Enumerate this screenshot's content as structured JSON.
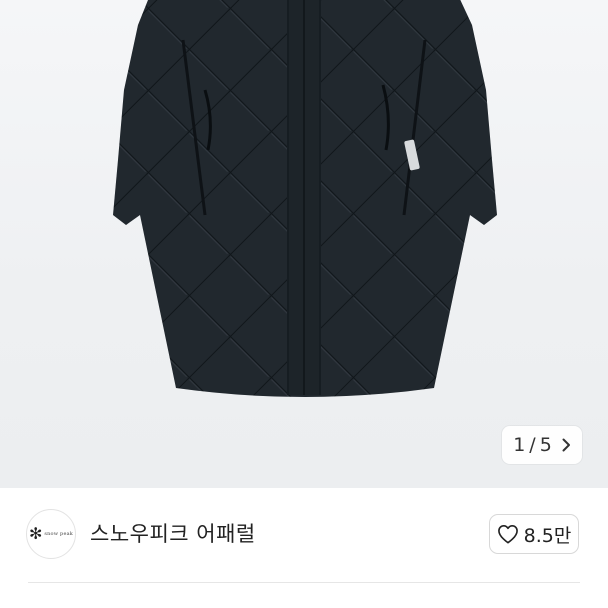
{
  "product_image": {
    "pager": {
      "current": "1",
      "separator": "/",
      "total": "5"
    }
  },
  "seller": {
    "avatar_text": "snow peak",
    "name": "스노우피크 어패럴"
  },
  "like_button": {
    "count": "8.5만"
  }
}
